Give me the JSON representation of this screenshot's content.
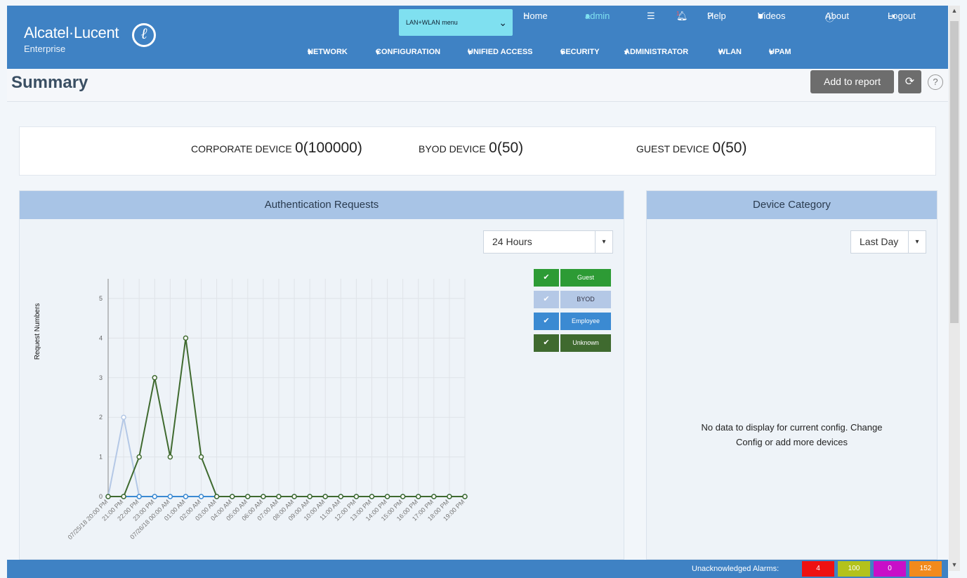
{
  "header": {
    "brand": "Alcatel·Lucent",
    "brand_sub": "Enterprise",
    "lan_menu": "LAN+WLAN menu",
    "links": {
      "home": "Home",
      "admin": "admin",
      "help": "Help",
      "videos": "Videos",
      "about": "About",
      "logout": "Logout"
    },
    "notification_badge": "1",
    "nav": [
      "NETWORK",
      "CONFIGURATION",
      "UNIFIED ACCESS",
      "SECURITY",
      "ADMINISTRATOR",
      "WLAN",
      "UPAM"
    ],
    "colors": {
      "bar": "#3f82c4",
      "lan_menu": "#7fe0f0"
    }
  },
  "page": {
    "title": "Summary",
    "add_to_report": "Add to report",
    "help_symbol": "?"
  },
  "stats": {
    "corporate_label": "CORPORATE DEVICE",
    "corporate_value": "0(100000)",
    "byod_label": "BYOD DEVICE",
    "byod_value": "0(50)",
    "guest_label": "GUEST DEVICE",
    "guest_value": "0(50)"
  },
  "auth_panel": {
    "title": "Authentication Requests",
    "range": "24 Hours",
    "legend": [
      {
        "name": "Guest",
        "color": "#2d9b35"
      },
      {
        "name": "BYOD",
        "color": "#b4c8e6"
      },
      {
        "name": "Employee",
        "color": "#3b8ad2"
      },
      {
        "name": "Unknown",
        "color": "#3f6a2f"
      }
    ]
  },
  "device_panel": {
    "title": "Device Category",
    "range": "Last Day",
    "no_data_1": "No data to display for current config. Change",
    "no_data_2": "Config or add more devices"
  },
  "footer": {
    "alarms_label": "Unacknowledged Alarms:",
    "alarms": [
      {
        "value": "4",
        "color": "#ee1111"
      },
      {
        "value": "100",
        "color": "#b3c21c"
      },
      {
        "value": "0",
        "color": "#c80fc8"
      },
      {
        "value": "152",
        "color": "#f28a1c"
      }
    ]
  },
  "chart_data": {
    "type": "line",
    "ylabel": "Request Numbers",
    "xlabel": "",
    "ylim": [
      0,
      5
    ],
    "yticks": [
      0,
      1,
      2,
      3,
      4,
      5
    ],
    "grid": true,
    "categories": [
      "07/25/18 20:00 PM",
      "21:00 PM",
      "22:00 PM",
      "23:00 PM",
      "07/26/18 00:00 AM",
      "01:00 AM",
      "02:00 AM",
      "03:00 AM",
      "04:00 AM",
      "05:00 AM",
      "06:00 AM",
      "07:00 AM",
      "08:00 AM",
      "09:00 AM",
      "10:00 AM",
      "11:00 AM",
      "12:00 PM",
      "13:00 PM",
      "14:00 PM",
      "15:00 PM",
      "16:00 PM",
      "17:00 PM",
      "18:00 PM",
      "19:00 PM"
    ],
    "series": [
      {
        "name": "BYOD",
        "color": "#b4c8e6",
        "values": [
          0,
          2,
          0,
          0,
          0,
          0,
          0,
          0,
          0,
          0,
          0,
          0,
          0,
          0,
          0,
          0,
          0,
          0,
          0,
          0,
          0,
          0,
          0,
          0
        ]
      },
      {
        "name": "Employee",
        "color": "#3b8ad2",
        "values": [
          0,
          0,
          0,
          0,
          0,
          0,
          0,
          0,
          0,
          0,
          0,
          0,
          0,
          0,
          0,
          0,
          0,
          0,
          0,
          0,
          0,
          0,
          0,
          0
        ]
      },
      {
        "name": "Unknown",
        "color": "#3f6a2f",
        "values": [
          0,
          0,
          1,
          3,
          1,
          4,
          1,
          0,
          0,
          0,
          0,
          0,
          0,
          0,
          0,
          0,
          0,
          0,
          0,
          0,
          0,
          0,
          0,
          0
        ]
      }
    ]
  }
}
